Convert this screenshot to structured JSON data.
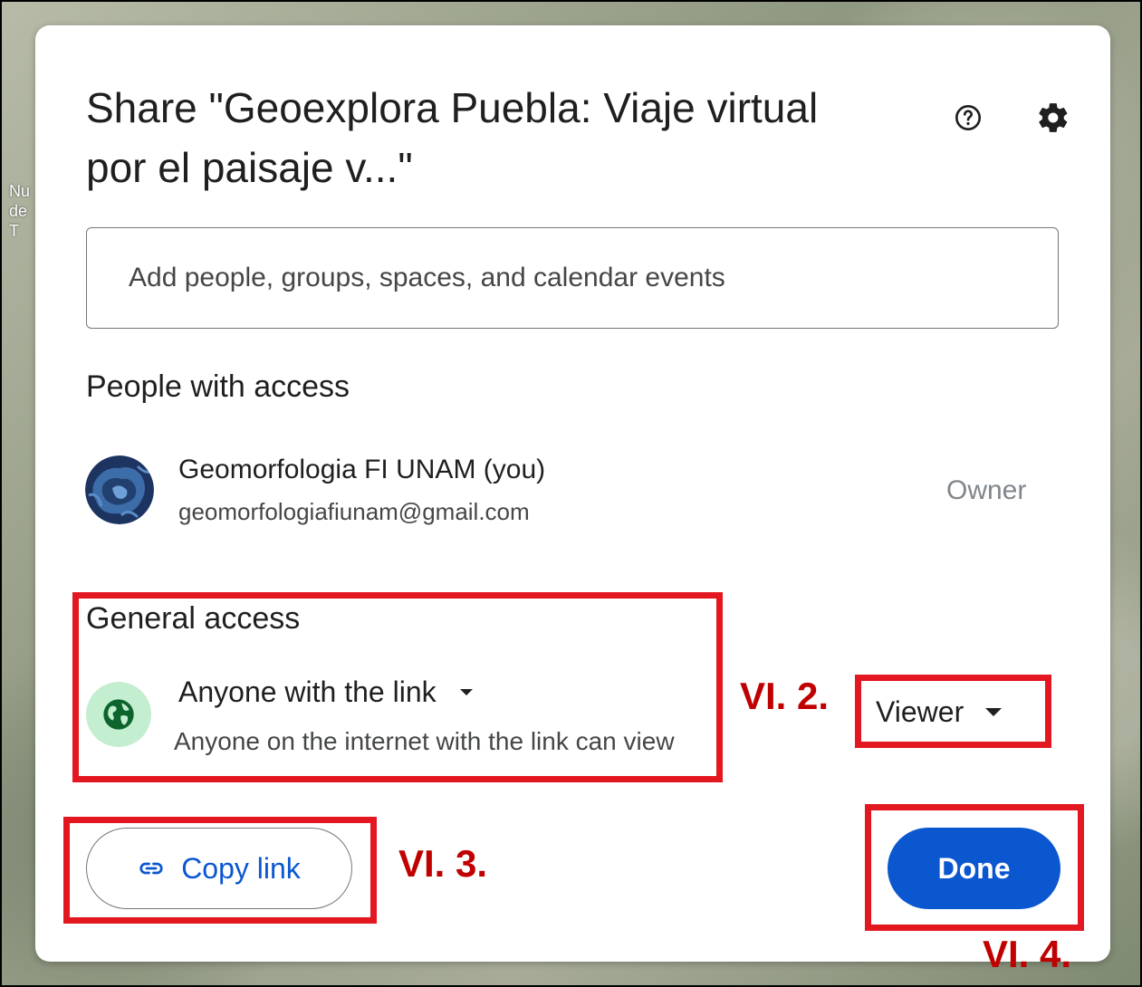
{
  "background": {
    "map_fragment_lines": [
      "Nu",
      "de",
      "T"
    ]
  },
  "dialog": {
    "title_line1": "Share \"Geoexplora Puebla: Viaje virtual",
    "title_line2": "por el paisaje v...\"",
    "help_icon": "help-circle-icon",
    "settings_icon": "gear-icon",
    "add_people_placeholder": "Add people, groups, spaces, and calendar events",
    "people_with_access_heading": "People with access",
    "people": [
      {
        "name": "Geomorfologia FI UNAM (you)",
        "email": "geomorfologiafiunam@gmail.com",
        "role": "Owner"
      }
    ],
    "general_access_heading": "General access",
    "general_access": {
      "option": "Anyone with the link",
      "description": "Anyone on the internet with the link can view",
      "role": "Viewer"
    },
    "copy_link_label": "Copy link",
    "done_label": "Done"
  },
  "annotations": {
    "step_2": "VI. 2.",
    "step_3": "VI. 3.",
    "step_4": "VI. 4.",
    "color": "#e3171f"
  },
  "colors": {
    "primary": "#0b57d0",
    "globe_bg": "#c4eed0",
    "globe_fg": "#0d652d"
  }
}
